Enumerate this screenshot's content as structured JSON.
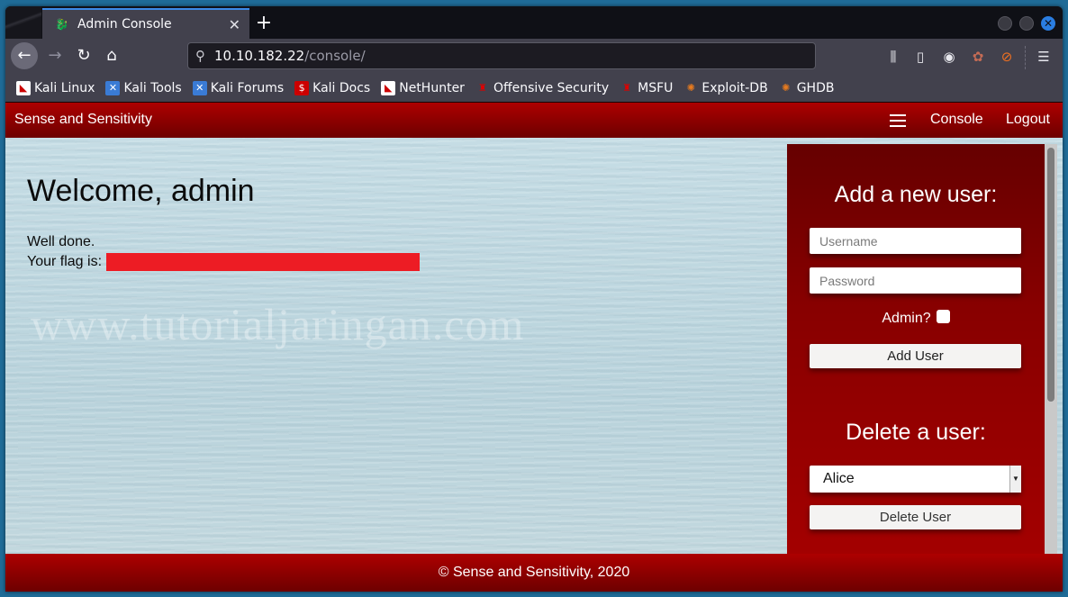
{
  "browser": {
    "tab": {
      "title": "Admin Console",
      "favicon": "kali-dragon-icon"
    },
    "url": {
      "host": "10.10.182.22",
      "path": "/console/"
    },
    "bookmarks": [
      {
        "label": "Kali Linux",
        "icon": "kali-linux-icon"
      },
      {
        "label": "Kali Tools",
        "icon": "kali-tools-icon"
      },
      {
        "label": "Kali Forums",
        "icon": "kali-forums-icon"
      },
      {
        "label": "Kali Docs",
        "icon": "kali-docs-icon"
      },
      {
        "label": "NetHunter",
        "icon": "nethunter-icon"
      },
      {
        "label": "Offensive Security",
        "icon": "offsec-icon"
      },
      {
        "label": "MSFU",
        "icon": "msfu-icon"
      },
      {
        "label": "Exploit-DB",
        "icon": "exploit-db-icon"
      },
      {
        "label": "GHDB",
        "icon": "ghdb-icon"
      }
    ]
  },
  "site": {
    "brand": "Sense and Sensitivity",
    "nav": {
      "console": "Console",
      "logout": "Logout"
    },
    "welcome": "Welcome, admin",
    "message_line1": "Well done.",
    "flag_label": "Your flag is:",
    "watermark": "www.tutorialjaringan.com",
    "footer": "© Sense and Sensitivity, 2020"
  },
  "panel": {
    "add_heading": "Add a new user:",
    "username_placeholder": "Username",
    "password_placeholder": "Password",
    "admin_label": "Admin?",
    "admin_checked": false,
    "add_button": "Add User",
    "delete_heading": "Delete a user:",
    "delete_selected": "Alice",
    "delete_button": "Delete User"
  },
  "colors": {
    "header_red": "#ad0000",
    "flag_redaction": "#ed1c24"
  }
}
